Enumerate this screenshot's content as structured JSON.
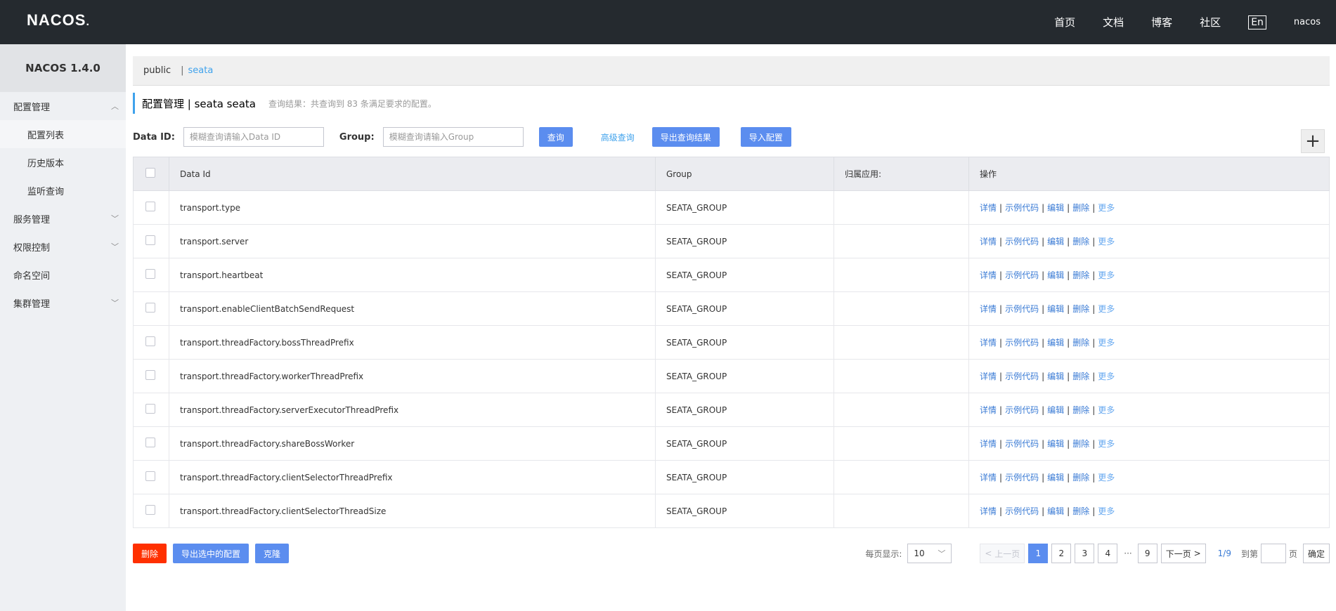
{
  "topbar": {
    "logo_text": "NACOS",
    "logo_dot": ".",
    "nav": [
      "首页",
      "文档",
      "博客",
      "社区"
    ],
    "lang": "En",
    "user": "nacos"
  },
  "sidebar": {
    "title": "NACOS 1.4.0",
    "config_group": "配置管理",
    "config_items": [
      "配置列表",
      "历史版本",
      "监听查询"
    ],
    "service_group": "服务管理",
    "auth_group": "权限控制",
    "namespace": "命名空间",
    "cluster_group": "集群管理"
  },
  "namespaces": {
    "public": "public",
    "separator": "|",
    "seata": "seata"
  },
  "header": {
    "title": "配置管理 | seata seata",
    "result_info": "查询结果：共查询到 83 条满足要求的配置。"
  },
  "search": {
    "data_id_label": "Data ID:",
    "data_id_placeholder": "模糊查询请输入Data ID",
    "group_label": "Group:",
    "group_placeholder": "模糊查询请输入Group",
    "query_btn": "查询",
    "advanced_link": "高级查询",
    "export_btn": "导出查询结果",
    "import_btn": "导入配置",
    "add_symbol": "+"
  },
  "table": {
    "headers": [
      "Data Id",
      "Group",
      "归属应用:",
      "操作"
    ],
    "rows": [
      {
        "data_id": "transport.type",
        "group": "SEATA_GROUP",
        "app": ""
      },
      {
        "data_id": "transport.server",
        "group": "SEATA_GROUP",
        "app": ""
      },
      {
        "data_id": "transport.heartbeat",
        "group": "SEATA_GROUP",
        "app": ""
      },
      {
        "data_id": "transport.enableClientBatchSendRequest",
        "group": "SEATA_GROUP",
        "app": ""
      },
      {
        "data_id": "transport.threadFactory.bossThreadPrefix",
        "group": "SEATA_GROUP",
        "app": ""
      },
      {
        "data_id": "transport.threadFactory.workerThreadPrefix",
        "group": "SEATA_GROUP",
        "app": ""
      },
      {
        "data_id": "transport.threadFactory.serverExecutorThreadPrefix",
        "group": "SEATA_GROUP",
        "app": ""
      },
      {
        "data_id": "transport.threadFactory.shareBossWorker",
        "group": "SEATA_GROUP",
        "app": ""
      },
      {
        "data_id": "transport.threadFactory.clientSelectorThreadPrefix",
        "group": "SEATA_GROUP",
        "app": ""
      },
      {
        "data_id": "transport.threadFactory.clientSelectorThreadSize",
        "group": "SEATA_GROUP",
        "app": ""
      }
    ],
    "ops": {
      "detail": "详情",
      "sample": "示例代码",
      "edit": "编辑",
      "delete": "删除",
      "more": "更多",
      "sep": "|"
    }
  },
  "bottom": {
    "delete_btn": "删除",
    "export_selected_btn": "导出选中的配置",
    "clone_btn": "克隆",
    "per_page_label": "每页显示:",
    "per_page_value": "10",
    "prev": "上一页",
    "pages": [
      "1",
      "2",
      "3",
      "4"
    ],
    "ellipsis": "···",
    "last_page": "9",
    "next": "下一页",
    "page_info": "1/9",
    "jump_label": "到第",
    "page_unit": "页",
    "confirm": "确定"
  }
}
